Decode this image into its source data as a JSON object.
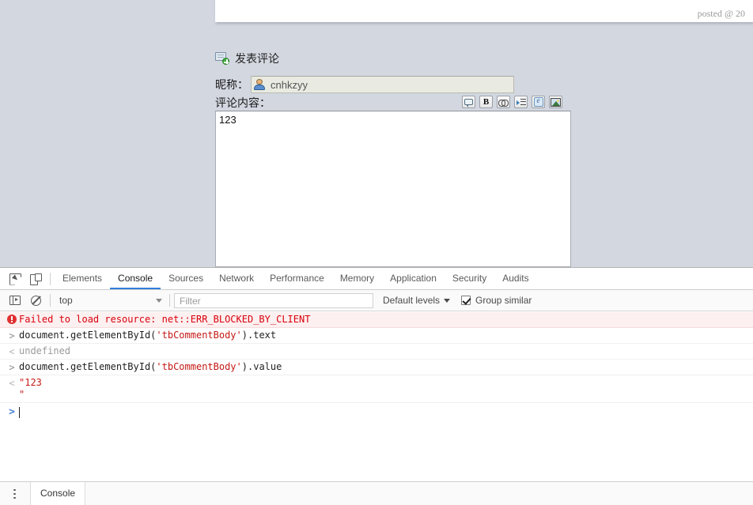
{
  "webpage": {
    "post_meta": "posted @ 20",
    "comment_section": {
      "icon": "add-comment-icon",
      "title": "发表评论",
      "nickname_label": "昵称：",
      "nickname_icon": "user-avatar-icon",
      "nickname_value": "cnhkzyy",
      "body_label": "评论内容：",
      "body_value": "123",
      "toolbar": [
        {
          "name": "quote-icon",
          "label": "引用"
        },
        {
          "name": "bold-icon",
          "label": "B"
        },
        {
          "name": "link-icon",
          "label": "链接"
        },
        {
          "name": "indent-icon",
          "label": "缩进"
        },
        {
          "name": "emoji-icon",
          "label": "表情"
        },
        {
          "name": "image-icon",
          "label": "图片"
        }
      ]
    }
  },
  "devtools": {
    "left_tools": [
      {
        "name": "inspect-element-icon",
        "label": "Inspect"
      },
      {
        "name": "toggle-device-toolbar-icon",
        "label": "Toggle device toolbar"
      }
    ],
    "tabs": [
      {
        "label": "Elements",
        "active": false
      },
      {
        "label": "Console",
        "active": true
      },
      {
        "label": "Sources",
        "active": false
      },
      {
        "label": "Network",
        "active": false
      },
      {
        "label": "Performance",
        "active": false
      },
      {
        "label": "Memory",
        "active": false
      },
      {
        "label": "Application",
        "active": false
      },
      {
        "label": "Security",
        "active": false
      },
      {
        "label": "Audits",
        "active": false
      }
    ],
    "filterbar": {
      "sidebar_icon": "console-sidebar-icon",
      "clear_icon": "clear-console-icon",
      "context": "top",
      "filter_placeholder": "Filter",
      "filter_value": "",
      "levels": "Default levels",
      "group_similar": "Group similar",
      "group_similar_checked": true
    },
    "console_rows": [
      {
        "type": "error",
        "gutter": "error-icon",
        "text": "Failed to load resource: net::ERR_BLOCKED_BY_CLIENT"
      },
      {
        "type": "input",
        "gutter": ">",
        "code_prefix": "document.getElementById(",
        "code_string": "'tbCommentBody'",
        "code_suffix": ").text"
      },
      {
        "type": "output",
        "gutter": "<",
        "text": "undefined"
      },
      {
        "type": "input",
        "gutter": ">",
        "code_prefix": "document.getElementById(",
        "code_string": "'tbCommentBody'",
        "code_suffix": ").value"
      },
      {
        "type": "output-string",
        "gutter": "<",
        "text": "\"123\n\""
      }
    ],
    "prompt": {
      "chevron": ">",
      "value": ""
    },
    "drawer": {
      "menu_icon": "more-options-icon",
      "tab": "Console"
    }
  },
  "colors": {
    "page_bg": "#d3d7e0",
    "accent": "#2f7fdb",
    "error_text": "#d8000c",
    "error_bg": "#fdf0f0",
    "string_literal": "#c41a16"
  }
}
